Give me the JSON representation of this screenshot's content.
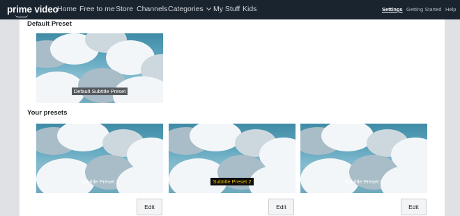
{
  "nav": {
    "logo": "prime video",
    "links": [
      "Home",
      "Free to me",
      "Store",
      "Channels",
      "Categories",
      "My Stuff",
      "Kids"
    ],
    "right_links": [
      "Settings",
      "Getting Started",
      "Help"
    ],
    "active_right": "Settings"
  },
  "default_section": {
    "title": "Default Preset",
    "caption": "Default Subtitle Preset"
  },
  "your_section": {
    "title": "Your presets",
    "presets": [
      {
        "caption": "Subtitle Preset 1",
        "edit_label": "Edit"
      },
      {
        "caption": "Subtitle Preset 2",
        "edit_label": "Edit"
      },
      {
        "caption": "Subtitle Preset 3",
        "edit_label": "Edit"
      }
    ]
  },
  "colors": {
    "nav_bg": "#1a242f",
    "page_bg": "#dfe1e4",
    "panel_bg": "#ffffff",
    "sky": "#5fa6bf",
    "preset2_text": "#f2c200",
    "preset2_bg": "#0d0d0d"
  }
}
